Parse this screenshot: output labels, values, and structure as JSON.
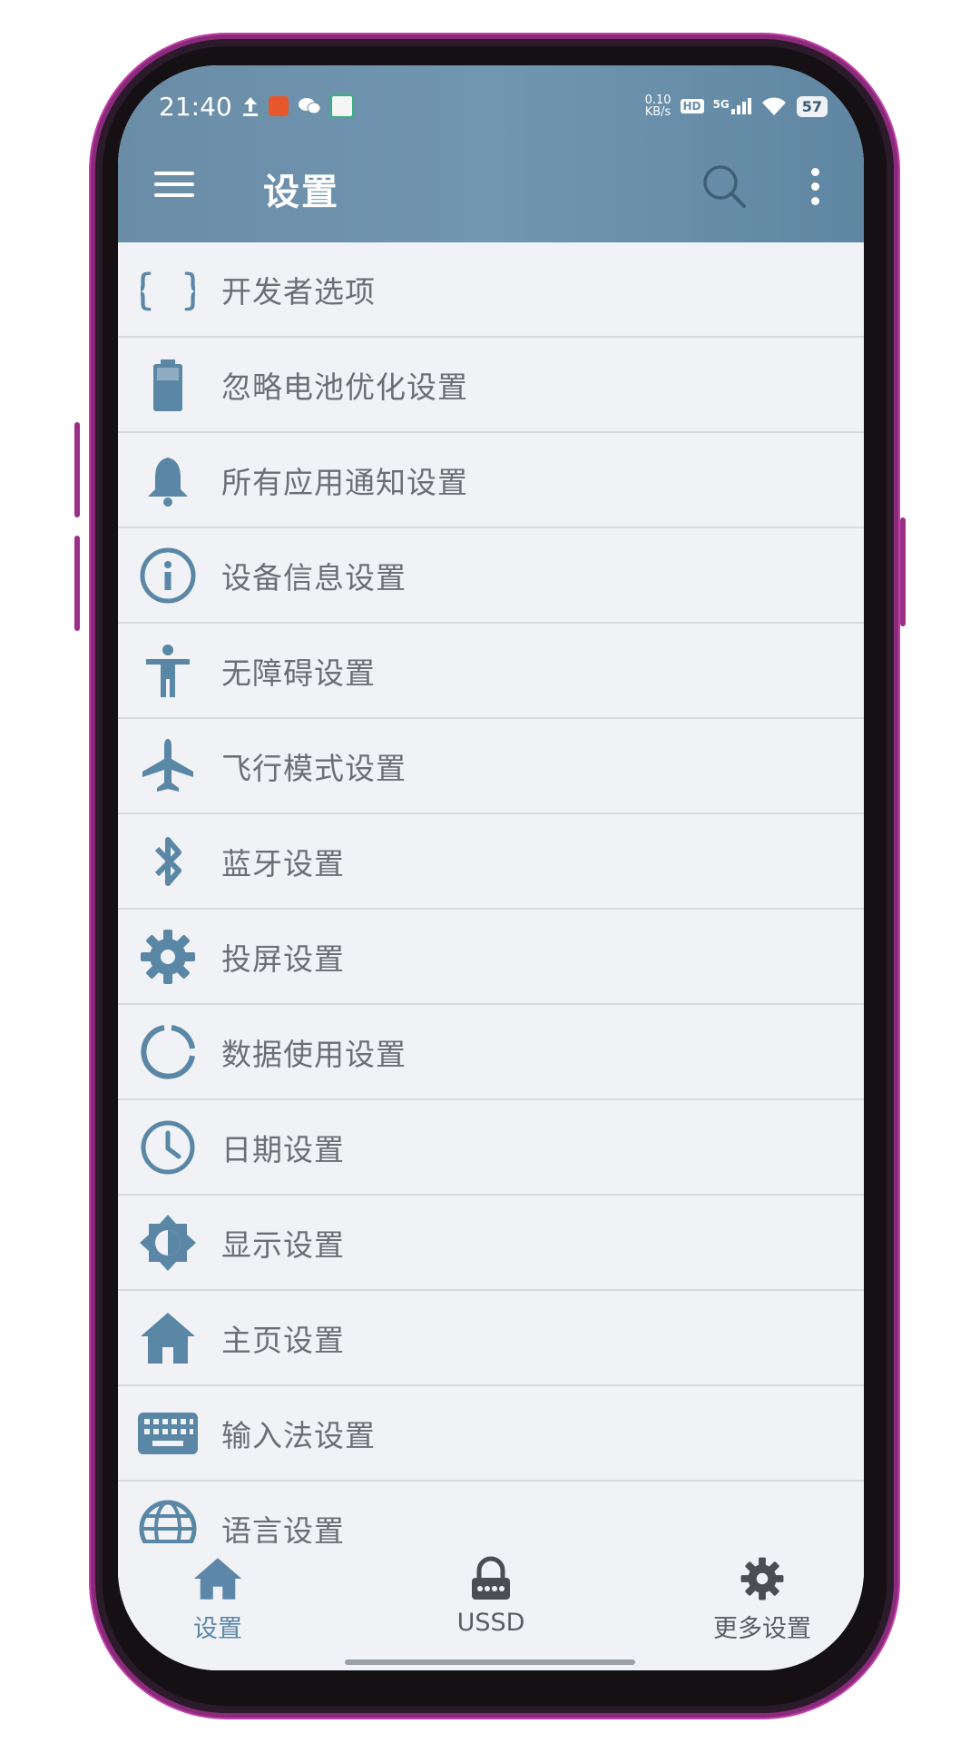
{
  "status_bar": {
    "time": "21:40",
    "net_speed_value": "0.10",
    "net_speed_unit": "KB/s",
    "hd_badge": "HD",
    "network": "5G",
    "battery": "57"
  },
  "app_bar": {
    "title": "设置"
  },
  "settings_items": [
    {
      "label": "开发者选项",
      "icon": "code-braces-icon"
    },
    {
      "label": "忽略电池优化设置",
      "icon": "battery-icon"
    },
    {
      "label": "所有应用通知设置",
      "icon": "bell-icon"
    },
    {
      "label": "设备信息设置",
      "icon": "info-icon"
    },
    {
      "label": "无障碍设置",
      "icon": "accessibility-icon"
    },
    {
      "label": "飞行模式设置",
      "icon": "airplane-icon"
    },
    {
      "label": "蓝牙设置",
      "icon": "bluetooth-icon"
    },
    {
      "label": "投屏设置",
      "icon": "gear-icon"
    },
    {
      "label": "数据使用设置",
      "icon": "data-usage-icon"
    },
    {
      "label": "日期设置",
      "icon": "clock-icon"
    },
    {
      "label": "显示设置",
      "icon": "brightness-icon"
    },
    {
      "label": "主页设置",
      "icon": "home-icon"
    },
    {
      "label": "输入法设置",
      "icon": "keyboard-icon"
    },
    {
      "label": "语言设置",
      "icon": "globe-icon"
    }
  ],
  "bottom_nav": {
    "items": [
      {
        "label": "设置",
        "icon": "home-icon",
        "active": true
      },
      {
        "label": "USSD",
        "icon": "lock-icon",
        "active": false
      },
      {
        "label": "更多设置",
        "icon": "gear-icon",
        "active": false
      }
    ]
  },
  "colors": {
    "accent": "#5d87a8",
    "icon": "#5b87a6",
    "topbar": "#6a8da7",
    "list_bg": "#f0f2f6",
    "divider": "#d6dadf",
    "text": "#6b6f73"
  }
}
